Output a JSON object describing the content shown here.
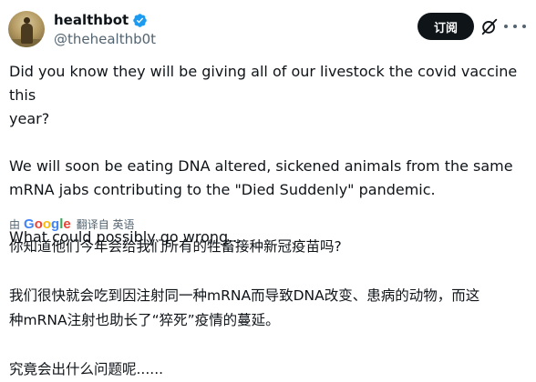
{
  "author": {
    "display_name": "healthbot",
    "handle": "@thehealthb0t",
    "verified": true,
    "avatar_icon": "avatar-photo"
  },
  "actions": {
    "subscribe_label": "订阅",
    "grok_icon": "grok-icon",
    "more_icon": "more-options-icon"
  },
  "tweet": {
    "lines": [
      "Did you know they will be giving all of our livestock the covid vaccine this",
      "year?",
      "",
      "We will soon be eating DNA altered, sickened animals from the same",
      "mRNA jabs contributing to the \"Died Suddenly\" pandemic.",
      "",
      "What could possibly go wrong..."
    ]
  },
  "translation": {
    "by_label": "由",
    "provider": "Google",
    "action_label": "翻译自 英语",
    "lines": [
      "你知道他们今年会给我们所有的牲畜接种新冠疫苗吗?",
      "",
      "我们很快就会吃到因注射同一种mRNA而导致DNA改变、患病的动物，而这",
      "种mRNA注射也助长了“猝死”疫情的蔓延。",
      "",
      "究竟会出什么问题呢......"
    ]
  },
  "colors": {
    "text": "#0f1419",
    "secondary": "#536471",
    "verified_badge": "#1d9bf0",
    "button_bg": "#0f1419"
  }
}
